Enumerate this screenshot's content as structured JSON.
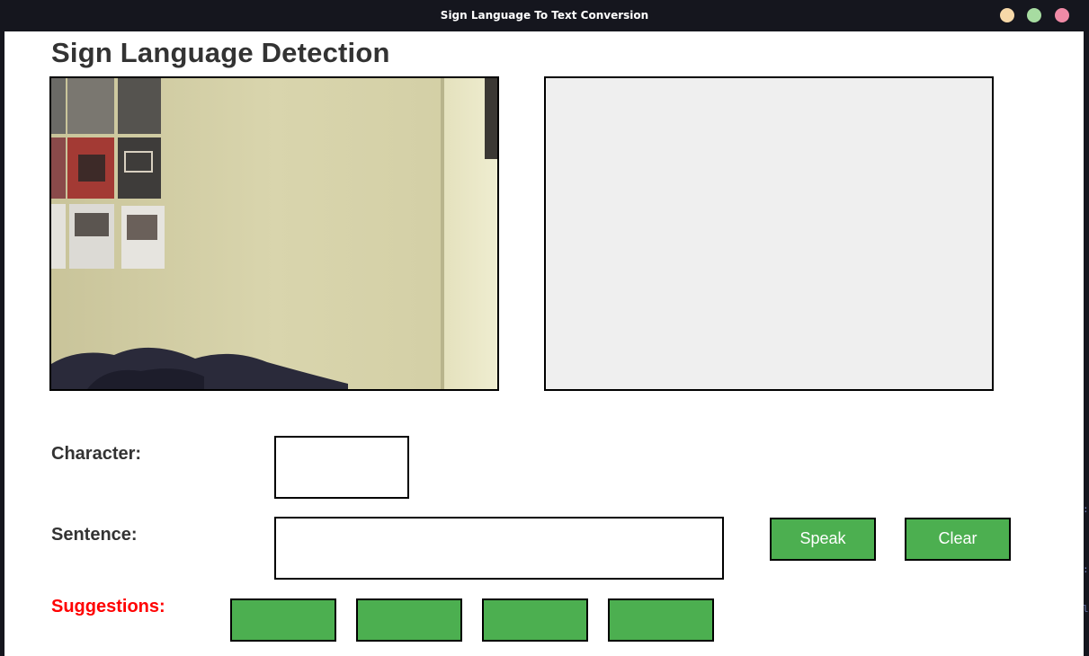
{
  "window": {
    "title": "Sign Language To Text Conversion"
  },
  "page": {
    "title": "Sign Language Detection"
  },
  "panels": {
    "camera": "webcam-feed",
    "skeleton": "hand-skeleton-canvas"
  },
  "labels": {
    "character": "Character:",
    "sentence": "Sentence:",
    "suggestions": "Suggestions:"
  },
  "values": {
    "character": "",
    "sentence": ""
  },
  "buttons": {
    "speak": "Speak",
    "clear": "Clear"
  },
  "suggestions": [
    "",
    "",
    "",
    ""
  ],
  "colors": {
    "button_green": "#4caf50",
    "suggestions_label": "#ff0000",
    "heading": "#333333",
    "titlebar": "#15161e"
  },
  "icons": {
    "minimize": "minimize-icon",
    "maximize": "maximize-icon",
    "close": "close-icon"
  }
}
